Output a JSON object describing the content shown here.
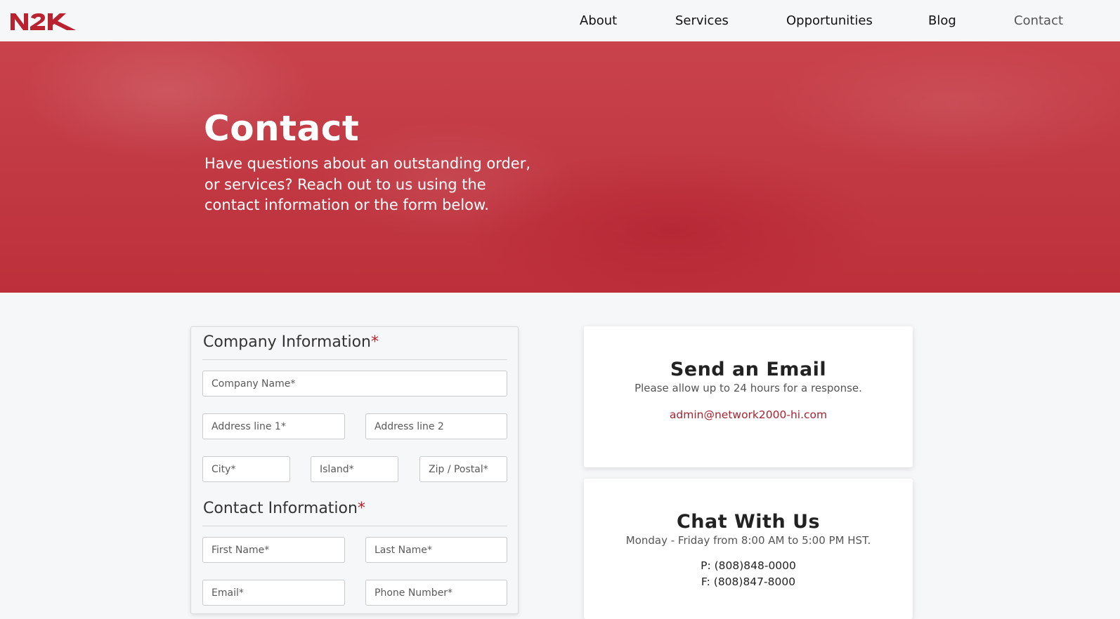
{
  "header": {
    "logo_text": "N2K",
    "nav": [
      {
        "label": "About"
      },
      {
        "label": "Services"
      },
      {
        "label": "Opportunities"
      },
      {
        "label": "Blog"
      },
      {
        "label": "Contact",
        "active": true
      }
    ]
  },
  "hero": {
    "title": "Contact",
    "subtitle": "Have questions about an outstanding order, or services? Reach out to us using the contact information or the form below."
  },
  "form": {
    "company": {
      "heading": "Company Information",
      "required_mark": "*",
      "company_name_placeholder": "Company Name*",
      "address1_placeholder": "Address line 1*",
      "address2_placeholder": "Address line 2",
      "city_placeholder": "City*",
      "island_placeholder": "Island*",
      "zip_placeholder": "Zip / Postal*"
    },
    "contact": {
      "heading": "Contact Information",
      "required_mark": "*",
      "first_name_placeholder": "First Name*",
      "last_name_placeholder": "Last Name*",
      "email_placeholder": "Email*",
      "phone_placeholder": "Phone Number*"
    }
  },
  "email_card": {
    "title": "Send an Email",
    "description": "Please allow up to 24 hours for a response.",
    "email": "admin@network2000-hi.com"
  },
  "chat_card": {
    "title": "Chat With Us",
    "description": "Monday - Friday from 8:00 AM to 5:00 PM HST.",
    "phone": "P: (808)848-0000",
    "fax": "F: (808)847-8000"
  },
  "colors": {
    "brand": "#b8232f",
    "hero": "#c23a44",
    "page_bg": "#f6f7f9"
  }
}
